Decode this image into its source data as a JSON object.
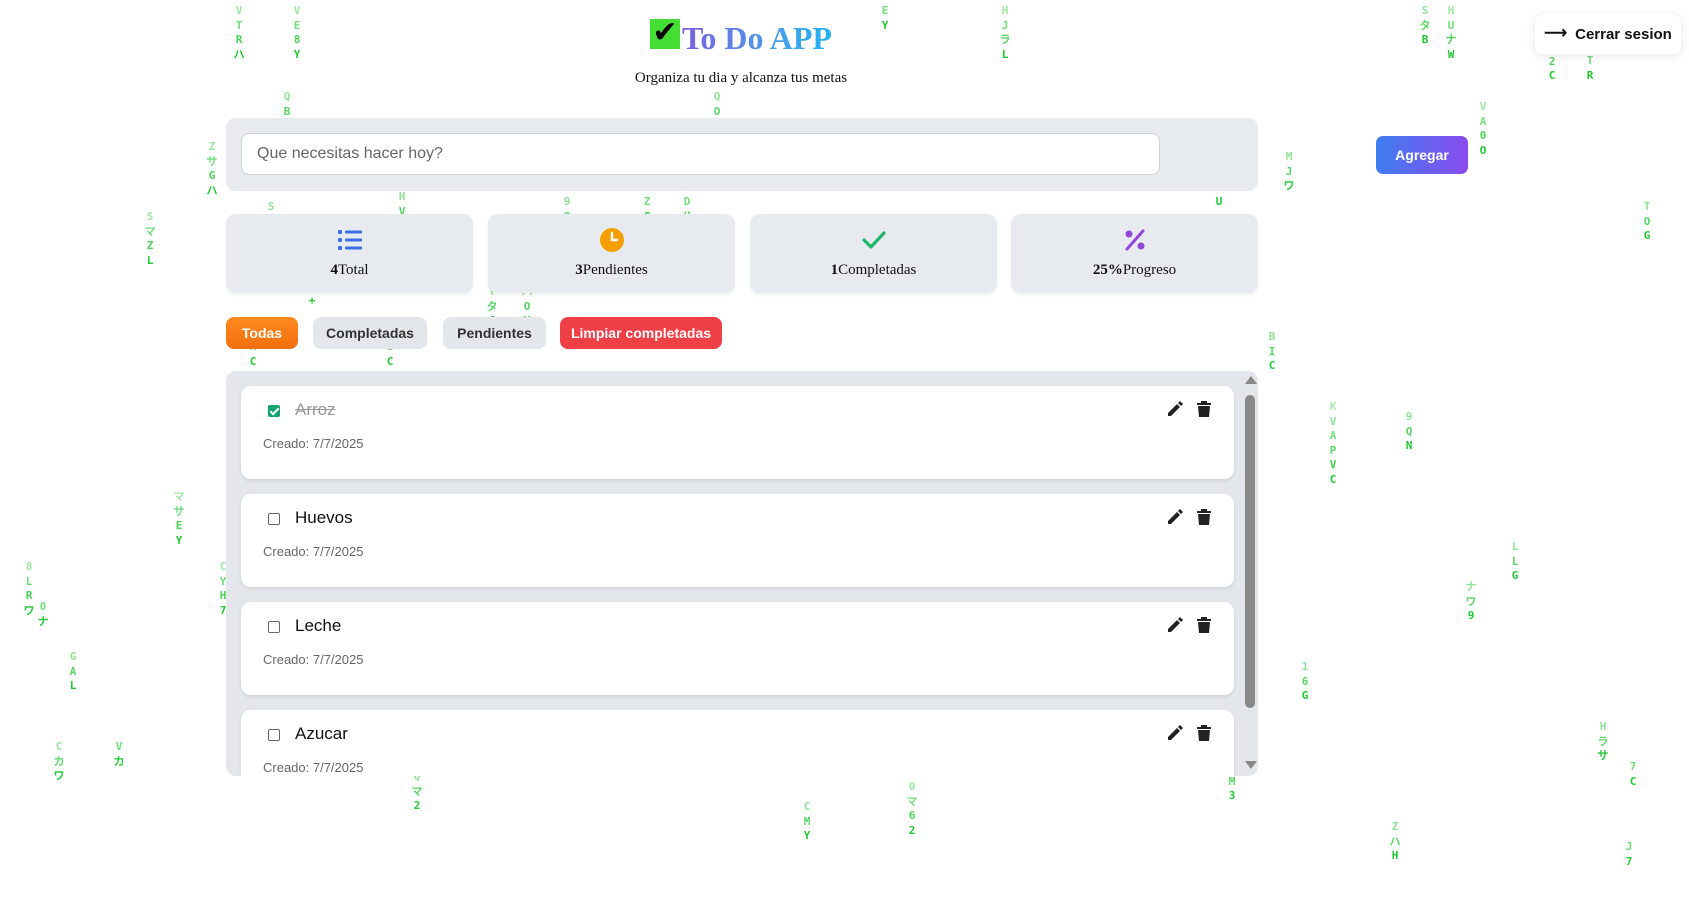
{
  "header": {
    "title": "To Do APP",
    "subtitle": "Organiza tu dia y alcanza tus metas"
  },
  "logout": {
    "label": "Cerrar sesion"
  },
  "add": {
    "placeholder": "Que necesitas hacer hoy?",
    "button_label": "Agregar"
  },
  "stats": [
    {
      "value": "4",
      "label": "Total",
      "icon": "list-icon",
      "color": "#3b6fe8"
    },
    {
      "value": "3",
      "label": "Pendientes",
      "icon": "clock-icon",
      "color": "#f5a000"
    },
    {
      "value": "1",
      "label": "Completadas",
      "icon": "check-icon",
      "color": "#1fb86b"
    },
    {
      "value": "25%",
      "label": "Progreso",
      "icon": "percent-icon",
      "color": "#8f46d9"
    }
  ],
  "filters": {
    "all": "Todas",
    "completed": "Completadas",
    "pending": "Pendientes",
    "clear": "Limpiar completadas"
  },
  "tasks": [
    {
      "name": "Arroz",
      "created": "Creado: 7/7/2025",
      "done": true
    },
    {
      "name": "Huevos",
      "created": "Creado: 7/7/2025",
      "done": false
    },
    {
      "name": "Leche",
      "created": "Creado: 7/7/2025",
      "done": false
    },
    {
      "name": "Azucar",
      "created": "Creado: 7/7/2025",
      "done": false
    }
  ],
  "background_rain": [
    "VTRハ",
    "VE8Y",
    "QBF",
    "EY",
    "HJラL",
    "SタB",
    "HUナW",
    "E2C",
    "TR",
    "ZサGハ",
    "SマZL",
    "QOW",
    "SGG",
    "9ON",
    "ヌDハY",
    "ZG",
    "HVタ",
    "ヤU",
    "MJワ",
    "RC",
    "IC",
    "B1+",
    "YタC",
    "ハOY",
    "BIC",
    "KVAPVC",
    "9QN",
    "VA0O",
    "マサEY",
    "CYH7",
    "TOG",
    "LLG",
    "ナワ9",
    "8LRワ",
    "0ナ",
    "GAL",
    "16G",
    "Cカワ",
    "Vカ",
    "Qマ2",
    "CMY",
    "0マ62",
    "HM3",
    "ZハH",
    "Hラサ",
    "7C",
    "J7"
  ]
}
